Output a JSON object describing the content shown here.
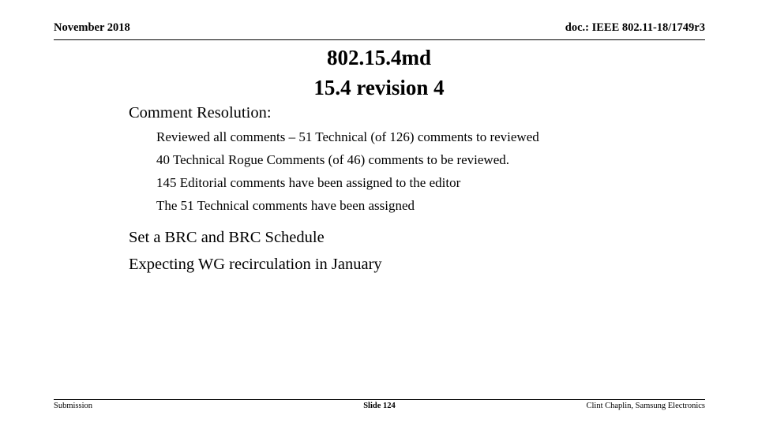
{
  "header": {
    "left": "November 2018",
    "right": "doc.: IEEE 802.11-18/1749r3"
  },
  "title": {
    "line1": "802.15.4md",
    "line2": "15.4 revision 4"
  },
  "body": {
    "heading": "Comment Resolution:",
    "sub_items": [
      "Reviewed all comments – 51 Technical (of 126) comments to reviewed",
      "40 Technical Rogue Comments (of 46) comments to be reviewed.",
      "145 Editorial comments have been assigned to the editor",
      "The 51 Technical comments have been assigned"
    ],
    "line_brc": "Set a BRC and BRC Schedule",
    "line_recirculation": "Expecting WG recirculation in January"
  },
  "footer": {
    "left": "Submission",
    "center": "Slide 124",
    "right": "Clint Chaplin, Samsung Electronics"
  },
  "colors": {
    "text": "#000000",
    "background": "#ffffff",
    "rule": "#000000"
  }
}
